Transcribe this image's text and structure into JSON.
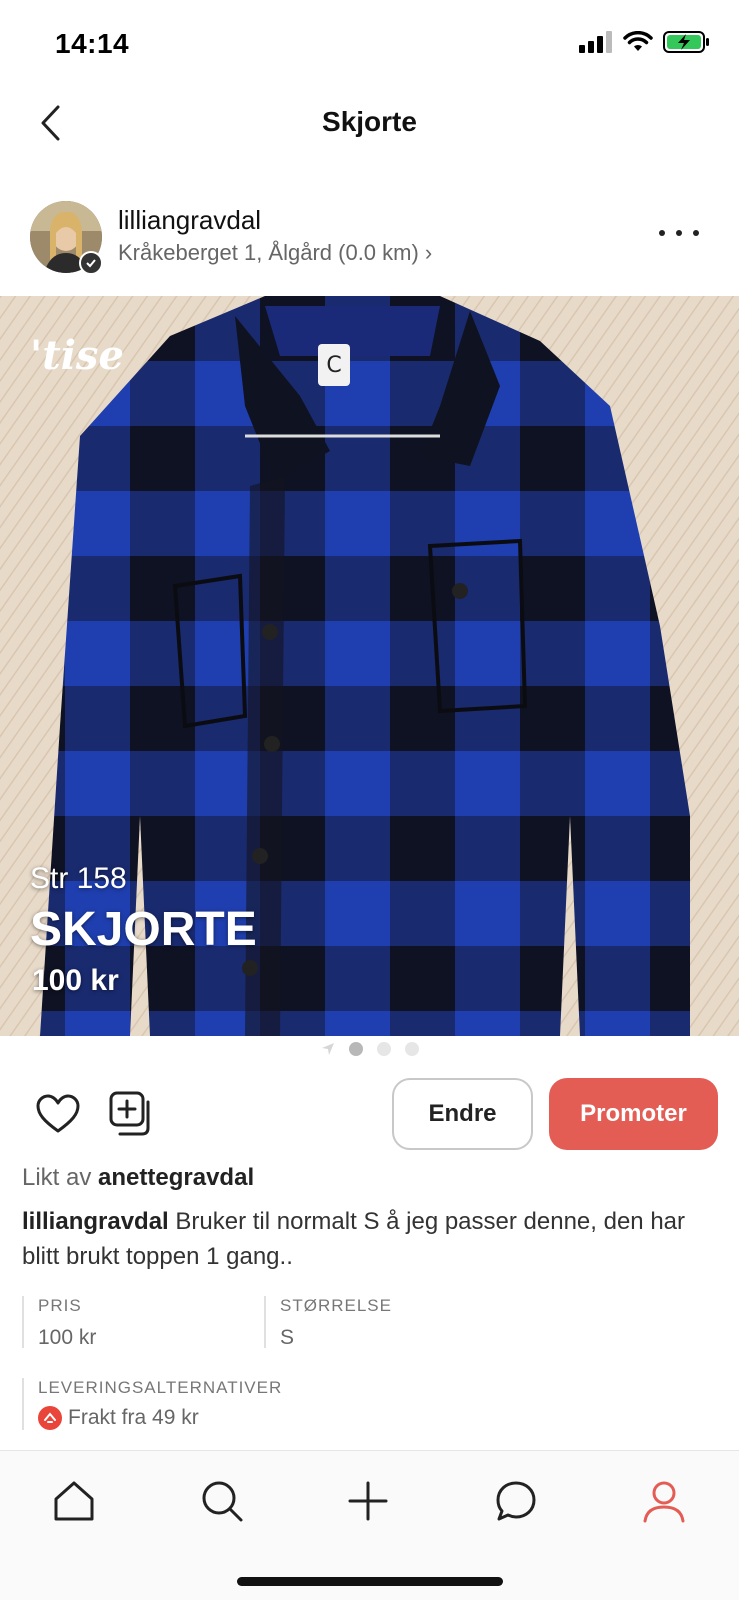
{
  "status_bar": {
    "time": "14:14"
  },
  "nav": {
    "title": "Skjorte"
  },
  "seller": {
    "username": "lilliangravdal",
    "location": "Kråkeberget 1, Ålgård (0.0 km) ›"
  },
  "listing": {
    "brand_watermark": "'tise",
    "size_overlay": "Str 158",
    "title_overlay": "SKJORTE",
    "price_overlay": "100 kr",
    "image_count": 3,
    "active_image": 1
  },
  "actions": {
    "edit_label": "Endre",
    "promote_label": "Promoter"
  },
  "liked_by": {
    "prefix": "Likt av",
    "user": "anettegravdal"
  },
  "description": {
    "author": "lilliangravdal",
    "text": "Bruker til normalt S å jeg passer denne, den har blitt brukt toppen 1 gang.."
  },
  "details": {
    "price_label": "PRIS",
    "price_value": "100 kr",
    "size_label": "STØRRELSE",
    "size_value": "S",
    "delivery_label": "LEVERINGSALTERNATIVER",
    "delivery_value": "Frakt fra 49 kr"
  },
  "tab_bar": {
    "tabs": [
      {
        "icon": "home-icon"
      },
      {
        "icon": "search-icon"
      },
      {
        "icon": "plus-icon"
      },
      {
        "icon": "chat-icon"
      },
      {
        "icon": "profile-icon",
        "active": true
      }
    ]
  },
  "colors": {
    "accent": "#e35d55",
    "shirt_blue": "#1f3fb0",
    "shirt_black": "#111318"
  }
}
